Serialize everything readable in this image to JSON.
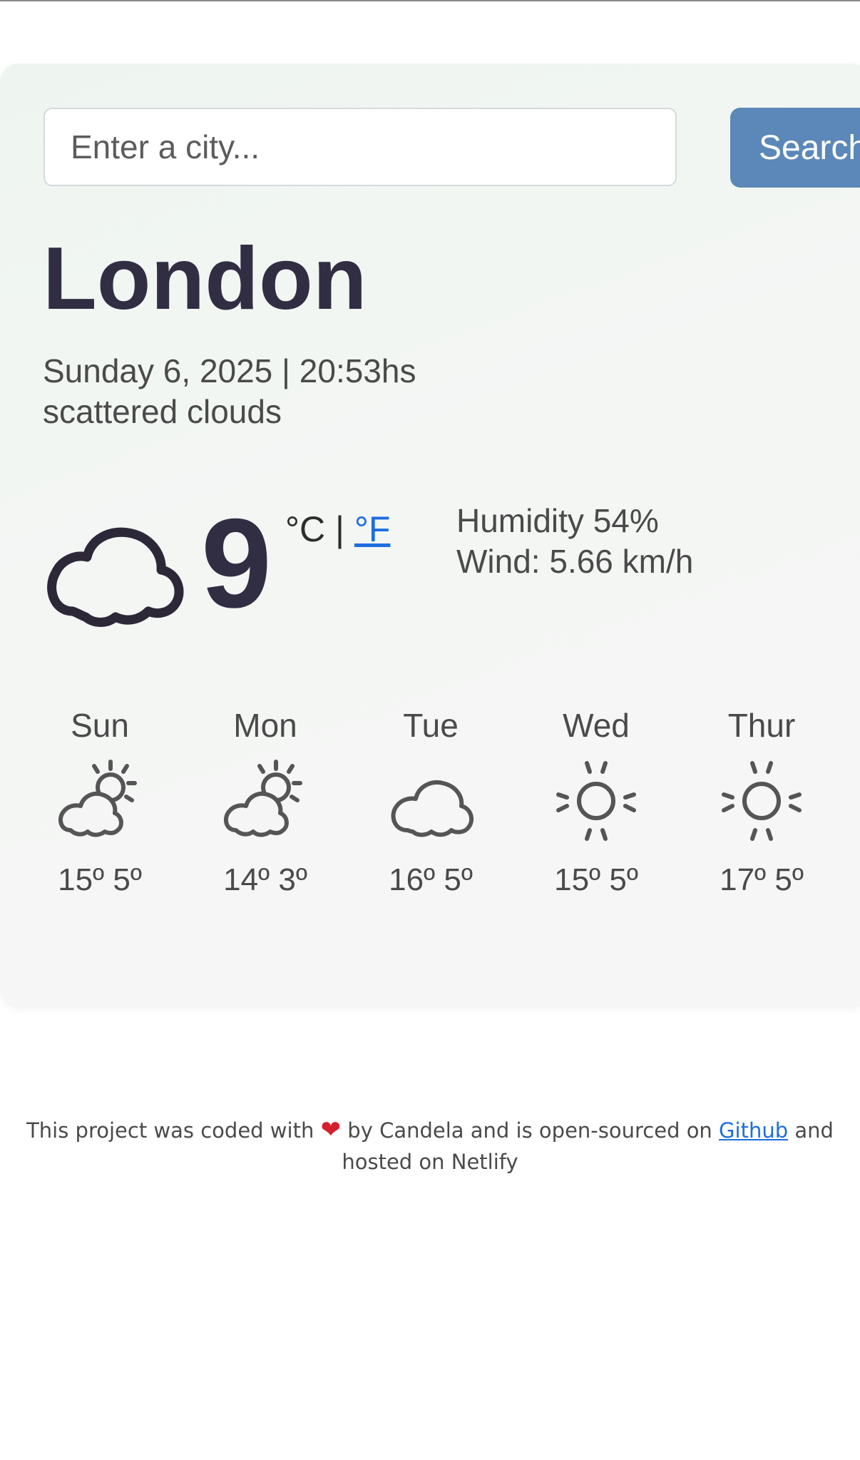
{
  "search": {
    "placeholder": "Enter a city...",
    "button_label": "Search"
  },
  "current": {
    "city": "London",
    "date": "Sunday 6, 2025 | 20:53hs",
    "description": "scattered clouds",
    "temperature": "9",
    "unit_celsius": "°C",
    "unit_separator": "|",
    "unit_fahrenheit": "°F",
    "humidity": "Humidity 54%",
    "wind": "Wind: 5.66 km/h",
    "icon": "cloud-icon"
  },
  "forecast": [
    {
      "day": "Sun",
      "temps": "15º 5º",
      "icon": "partly-cloudy-icon"
    },
    {
      "day": "Mon",
      "temps": "14º 3º",
      "icon": "partly-cloudy-icon"
    },
    {
      "day": "Tue",
      "temps": "16º 5º",
      "icon": "cloud-icon"
    },
    {
      "day": "Wed",
      "temps": "15º 5º",
      "icon": "sun-icon"
    },
    {
      "day": "Thur",
      "temps": "17º 5º",
      "icon": "sun-icon"
    }
  ],
  "footer": {
    "text_before": "This project was coded with",
    "heart": "❤",
    "text_middle": "by Candela and is open-sourced on",
    "github_link": "Github",
    "text_after": "and",
    "line2": "hosted on Netlify"
  },
  "colors": {
    "search_button": "#5b88b8",
    "heading": "#312e44",
    "link": "#1d6ee0"
  }
}
